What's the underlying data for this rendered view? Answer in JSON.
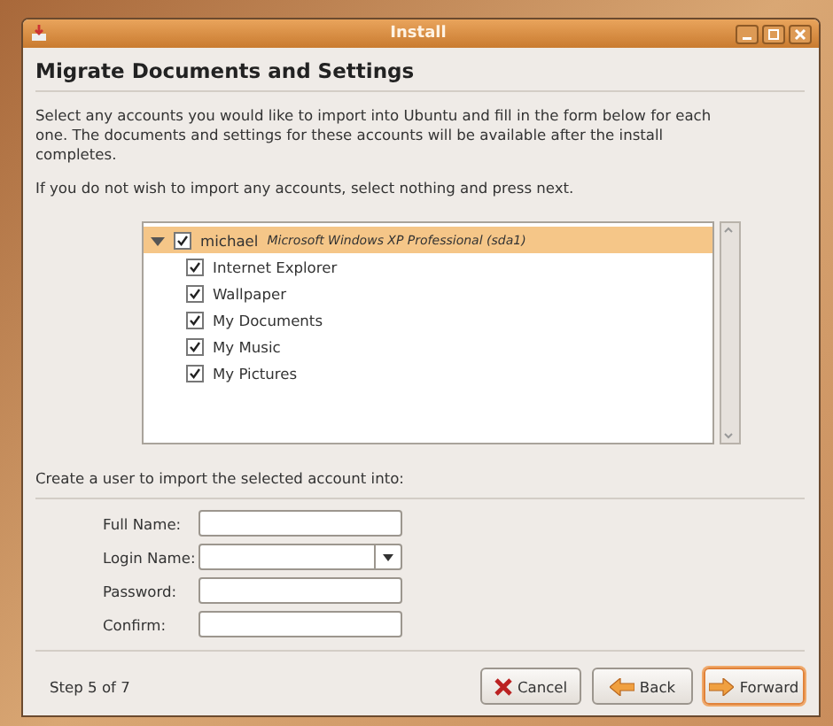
{
  "window": {
    "title": "Install"
  },
  "heading": "Migrate Documents and Settings",
  "intro": "Select any accounts you would like to import into Ubuntu and fill in the form below for each one.  The documents and settings for these accounts will be available after the install completes.",
  "note": "If you do not wish to import any accounts, select nothing and press next.",
  "accounts": [
    {
      "name": "michael",
      "system": "Microsoft Windows XP Professional (sda1)",
      "checked": true,
      "expanded": true,
      "selected": true,
      "children": [
        {
          "label": "Internet Explorer",
          "checked": true
        },
        {
          "label": "Wallpaper",
          "checked": true
        },
        {
          "label": "My Documents",
          "checked": true
        },
        {
          "label": "My Music",
          "checked": true
        },
        {
          "label": "My Pictures",
          "checked": true
        }
      ]
    }
  ],
  "form_title": "Create a user to import the selected account into:",
  "fields": [
    {
      "label": "Full Name:",
      "kind": "text"
    },
    {
      "label": "Login Name:",
      "kind": "combo"
    },
    {
      "label": "Password:",
      "kind": "text"
    },
    {
      "label": "Confirm:",
      "kind": "text"
    }
  ],
  "step": "Step 5 of 7",
  "buttons": [
    {
      "label": "Cancel",
      "kind": "cancel"
    },
    {
      "label": "Back",
      "kind": "back"
    },
    {
      "label": "Forward",
      "kind": "forward"
    }
  ]
}
